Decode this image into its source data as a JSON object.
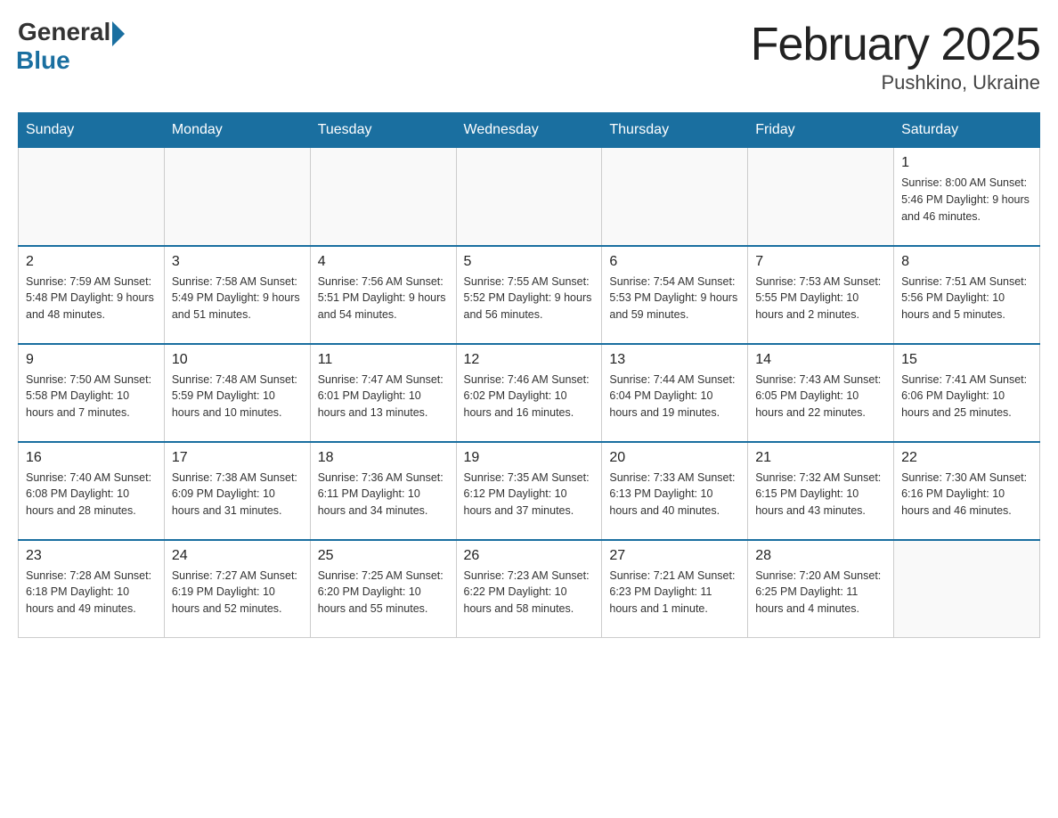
{
  "header": {
    "logo_general": "General",
    "logo_blue": "Blue",
    "month_title": "February 2025",
    "subtitle": "Pushkino, Ukraine"
  },
  "weekdays": [
    "Sunday",
    "Monday",
    "Tuesday",
    "Wednesday",
    "Thursday",
    "Friday",
    "Saturday"
  ],
  "weeks": [
    [
      {
        "day": "",
        "info": ""
      },
      {
        "day": "",
        "info": ""
      },
      {
        "day": "",
        "info": ""
      },
      {
        "day": "",
        "info": ""
      },
      {
        "day": "",
        "info": ""
      },
      {
        "day": "",
        "info": ""
      },
      {
        "day": "1",
        "info": "Sunrise: 8:00 AM\nSunset: 5:46 PM\nDaylight: 9 hours\nand 46 minutes."
      }
    ],
    [
      {
        "day": "2",
        "info": "Sunrise: 7:59 AM\nSunset: 5:48 PM\nDaylight: 9 hours\nand 48 minutes."
      },
      {
        "day": "3",
        "info": "Sunrise: 7:58 AM\nSunset: 5:49 PM\nDaylight: 9 hours\nand 51 minutes."
      },
      {
        "day": "4",
        "info": "Sunrise: 7:56 AM\nSunset: 5:51 PM\nDaylight: 9 hours\nand 54 minutes."
      },
      {
        "day": "5",
        "info": "Sunrise: 7:55 AM\nSunset: 5:52 PM\nDaylight: 9 hours\nand 56 minutes."
      },
      {
        "day": "6",
        "info": "Sunrise: 7:54 AM\nSunset: 5:53 PM\nDaylight: 9 hours\nand 59 minutes."
      },
      {
        "day": "7",
        "info": "Sunrise: 7:53 AM\nSunset: 5:55 PM\nDaylight: 10 hours\nand 2 minutes."
      },
      {
        "day": "8",
        "info": "Sunrise: 7:51 AM\nSunset: 5:56 PM\nDaylight: 10 hours\nand 5 minutes."
      }
    ],
    [
      {
        "day": "9",
        "info": "Sunrise: 7:50 AM\nSunset: 5:58 PM\nDaylight: 10 hours\nand 7 minutes."
      },
      {
        "day": "10",
        "info": "Sunrise: 7:48 AM\nSunset: 5:59 PM\nDaylight: 10 hours\nand 10 minutes."
      },
      {
        "day": "11",
        "info": "Sunrise: 7:47 AM\nSunset: 6:01 PM\nDaylight: 10 hours\nand 13 minutes."
      },
      {
        "day": "12",
        "info": "Sunrise: 7:46 AM\nSunset: 6:02 PM\nDaylight: 10 hours\nand 16 minutes."
      },
      {
        "day": "13",
        "info": "Sunrise: 7:44 AM\nSunset: 6:04 PM\nDaylight: 10 hours\nand 19 minutes."
      },
      {
        "day": "14",
        "info": "Sunrise: 7:43 AM\nSunset: 6:05 PM\nDaylight: 10 hours\nand 22 minutes."
      },
      {
        "day": "15",
        "info": "Sunrise: 7:41 AM\nSunset: 6:06 PM\nDaylight: 10 hours\nand 25 minutes."
      }
    ],
    [
      {
        "day": "16",
        "info": "Sunrise: 7:40 AM\nSunset: 6:08 PM\nDaylight: 10 hours\nand 28 minutes."
      },
      {
        "day": "17",
        "info": "Sunrise: 7:38 AM\nSunset: 6:09 PM\nDaylight: 10 hours\nand 31 minutes."
      },
      {
        "day": "18",
        "info": "Sunrise: 7:36 AM\nSunset: 6:11 PM\nDaylight: 10 hours\nand 34 minutes."
      },
      {
        "day": "19",
        "info": "Sunrise: 7:35 AM\nSunset: 6:12 PM\nDaylight: 10 hours\nand 37 minutes."
      },
      {
        "day": "20",
        "info": "Sunrise: 7:33 AM\nSunset: 6:13 PM\nDaylight: 10 hours\nand 40 minutes."
      },
      {
        "day": "21",
        "info": "Sunrise: 7:32 AM\nSunset: 6:15 PM\nDaylight: 10 hours\nand 43 minutes."
      },
      {
        "day": "22",
        "info": "Sunrise: 7:30 AM\nSunset: 6:16 PM\nDaylight: 10 hours\nand 46 minutes."
      }
    ],
    [
      {
        "day": "23",
        "info": "Sunrise: 7:28 AM\nSunset: 6:18 PM\nDaylight: 10 hours\nand 49 minutes."
      },
      {
        "day": "24",
        "info": "Sunrise: 7:27 AM\nSunset: 6:19 PM\nDaylight: 10 hours\nand 52 minutes."
      },
      {
        "day": "25",
        "info": "Sunrise: 7:25 AM\nSunset: 6:20 PM\nDaylight: 10 hours\nand 55 minutes."
      },
      {
        "day": "26",
        "info": "Sunrise: 7:23 AM\nSunset: 6:22 PM\nDaylight: 10 hours\nand 58 minutes."
      },
      {
        "day": "27",
        "info": "Sunrise: 7:21 AM\nSunset: 6:23 PM\nDaylight: 11 hours\nand 1 minute."
      },
      {
        "day": "28",
        "info": "Sunrise: 7:20 AM\nSunset: 6:25 PM\nDaylight: 11 hours\nand 4 minutes."
      },
      {
        "day": "",
        "info": ""
      }
    ]
  ]
}
